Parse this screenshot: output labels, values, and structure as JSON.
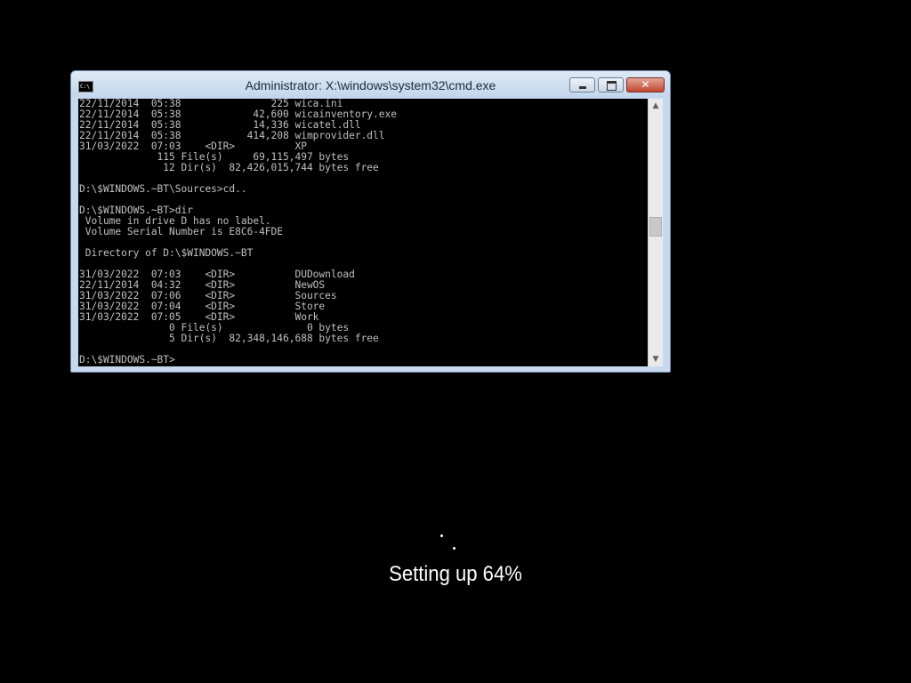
{
  "window": {
    "title": "Administrator: X:\\windows\\system32\\cmd.exe",
    "app_icon": "cmd-icon",
    "app_icon_text": "C:\\",
    "close_glyph": "✕"
  },
  "console": {
    "lines": [
      "22/11/2014  05:38               225 wica.ini",
      "22/11/2014  05:38            42,600 wicainventory.exe",
      "22/11/2014  05:38            14,336 wicatel.dll",
      "22/11/2014  05:38           414,208 wimprovider.dll",
      "31/03/2022  07:03    <DIR>          XP",
      "             115 File(s)     69,115,497 bytes",
      "              12 Dir(s)  82,426,015,744 bytes free",
      "",
      "D:\\$WINDOWS.~BT\\Sources>cd..",
      "",
      "D:\\$WINDOWS.~BT>dir",
      " Volume in drive D has no label.",
      " Volume Serial Number is E8C6-4FDE",
      "",
      " Directory of D:\\$WINDOWS.~BT",
      "",
      "31/03/2022  07:03    <DIR>          DUDownload",
      "22/11/2014  04:32    <DIR>          NewOS",
      "31/03/2022  07:06    <DIR>          Sources",
      "31/03/2022  07:04    <DIR>          Store",
      "31/03/2022  07:05    <DIR>          Work",
      "               0 File(s)              0 bytes",
      "               5 Dir(s)  82,348,146,688 bytes free",
      "",
      "D:\\$WINDOWS.~BT>"
    ]
  },
  "setup": {
    "status_text": "Setting up 64%",
    "progress_percent": 64
  },
  "colors": {
    "desktop_background": "#000000",
    "console_background": "#000000",
    "console_text": "#c0c0c0",
    "window_frame": "#c7d9ee",
    "close_button": "#c2452f"
  },
  "icons": {
    "minimize": "minimize-icon",
    "maximize": "maximize-icon",
    "close": "close-icon",
    "scroll_up": "chevron-up-icon",
    "scroll_down": "chevron-down-icon"
  }
}
